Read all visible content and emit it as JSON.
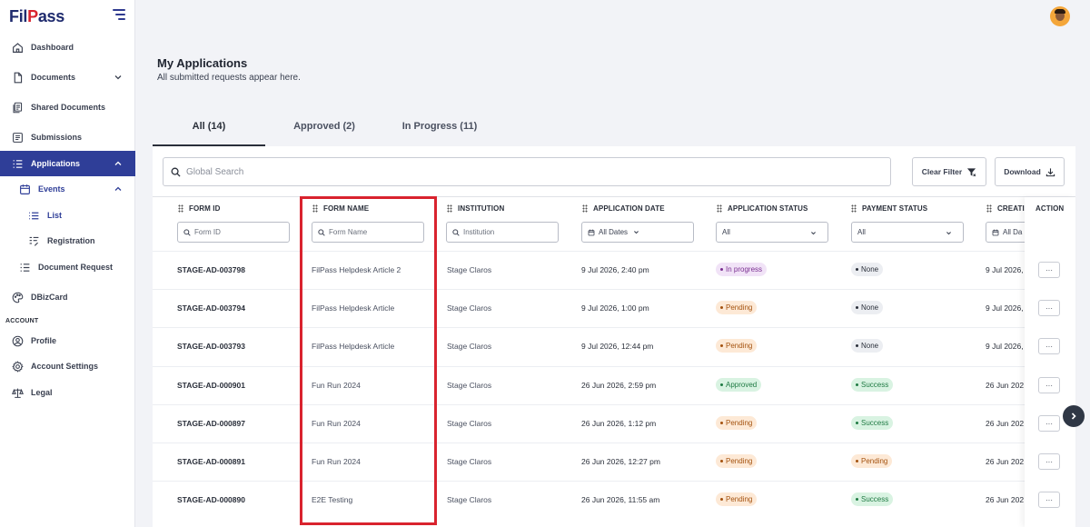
{
  "app": {
    "logo_prefix": "Fil",
    "logo_accent": "P",
    "logo_suffix": "ass"
  },
  "sidebar": {
    "items": [
      {
        "label": "Dashboard",
        "icon": "home-icon"
      },
      {
        "label": "Documents",
        "icon": "document-icon"
      },
      {
        "label": "Shared Documents",
        "icon": "shared-documents-icon"
      },
      {
        "label": "Submissions",
        "icon": "submissions-icon"
      },
      {
        "label": "Applications",
        "icon": "applications-icon"
      },
      {
        "label": "Events",
        "icon": "calendar-icon"
      },
      {
        "label": "List",
        "icon": "list-icon"
      },
      {
        "label": "Registration",
        "icon": "registration-icon"
      },
      {
        "label": "Document Request",
        "icon": "document-request-icon"
      },
      {
        "label": "DBizCard",
        "icon": "palette-icon"
      }
    ],
    "account_label": "ACCOUNT",
    "account_items": [
      {
        "label": "Profile",
        "icon": "profile-icon"
      },
      {
        "label": "Account Settings",
        "icon": "settings-icon"
      },
      {
        "label": "Legal",
        "icon": "scale-icon"
      }
    ]
  },
  "page": {
    "title": "My Applications",
    "subtitle": "All submitted requests appear here."
  },
  "tabs": [
    {
      "label": "All (14)"
    },
    {
      "label": "Approved (2)"
    },
    {
      "label": "In Progress (11)"
    }
  ],
  "toolbar": {
    "search_placeholder": "Global Search",
    "clear_filter_label": "Clear Filter",
    "download_label": "Download"
  },
  "table": {
    "columns": [
      {
        "label": "FORM ID",
        "filter_placeholder": "Form ID"
      },
      {
        "label": "FORM NAME",
        "filter_placeholder": "Form Name"
      },
      {
        "label": "INSTITUTION",
        "filter_placeholder": "Institution"
      },
      {
        "label": "APPLICATION DATE",
        "filter_value": "All Dates"
      },
      {
        "label": "APPLICATION STATUS",
        "filter_value": "All"
      },
      {
        "label": "PAYMENT STATUS",
        "filter_value": "All"
      },
      {
        "label": "CREATI",
        "filter_value": "All Da"
      },
      {
        "label": "ACTION"
      }
    ],
    "rows": [
      {
        "form_id": "STAGE-AD-003798",
        "form_name": "FilPass Helpdesk Article 2",
        "institution": "Stage Claros",
        "date": "9 Jul 2026, 2:40 pm",
        "app_status": "In progress",
        "pay_status": "None",
        "created": "9 Jul 2026,",
        "action": "···"
      },
      {
        "form_id": "STAGE-AD-003794",
        "form_name": "FilPass Helpdesk Article",
        "institution": "Stage Claros",
        "date": "9 Jul 2026, 1:00 pm",
        "app_status": "Pending",
        "pay_status": "None",
        "created": "9 Jul 2026,",
        "action": "···"
      },
      {
        "form_id": "STAGE-AD-003793",
        "form_name": "FilPass Helpdesk Article",
        "institution": "Stage Claros",
        "date": "9 Jul 2026, 12:44 pm",
        "app_status": "Pending",
        "pay_status": "None",
        "created": "9 Jul 2026,",
        "action": "···"
      },
      {
        "form_id": "STAGE-AD-000901",
        "form_name": "Fun Run 2024",
        "institution": "Stage Claros",
        "date": "26 Jun 2026, 2:59 pm",
        "app_status": "Approved",
        "pay_status": "Success",
        "created": "26 Jun 202",
        "action": "···"
      },
      {
        "form_id": "STAGE-AD-000897",
        "form_name": "Fun Run 2024",
        "institution": "Stage Claros",
        "date": "26 Jun 2026, 1:12 pm",
        "app_status": "Pending",
        "pay_status": "Success",
        "created": "26 Jun 202",
        "action": "···"
      },
      {
        "form_id": "STAGE-AD-000891",
        "form_name": "Fun Run 2024",
        "institution": "Stage Claros",
        "date": "26 Jun 2026, 12:27 pm",
        "app_status": "Pending",
        "pay_status": "Pending",
        "created": "26 Jun 202",
        "action": "···"
      },
      {
        "form_id": "STAGE-AD-000890",
        "form_name": "E2E Testing",
        "institution": "Stage Claros",
        "date": "26 Jun 2026, 11:55 am",
        "app_status": "Pending",
        "pay_status": "Success",
        "created": "26 Jun 202",
        "action": "···"
      }
    ]
  },
  "colors": {
    "brand_navy": "#2f3e98",
    "brand_red": "#d9232e",
    "highlight_border": "#d9232e",
    "status_in_progress": "#f1e3f7",
    "status_pending": "#fde9d6",
    "status_approved": "#d9f3e2",
    "status_none": "#eceef2",
    "status_success": "#d9f3e2"
  }
}
